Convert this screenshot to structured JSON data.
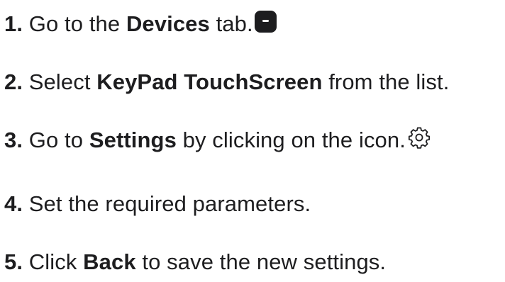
{
  "steps": [
    {
      "number": "1.",
      "before": "Go to the",
      "strong": "Devices",
      "after": "tab.",
      "icon": "devices-tab-icon"
    },
    {
      "number": "2.",
      "before": "Select",
      "strong": "KeyPad TouchScreen",
      "after": "from the list."
    },
    {
      "number": "3.",
      "before": "Go to",
      "strong": "Settings",
      "after": "by clicking on the icon.",
      "icon": "gear-icon"
    },
    {
      "number": "4.",
      "text": "Set the required parameters."
    },
    {
      "number": "5.",
      "before": "Click",
      "strong": "Back",
      "after": "to save the new settings."
    }
  ]
}
